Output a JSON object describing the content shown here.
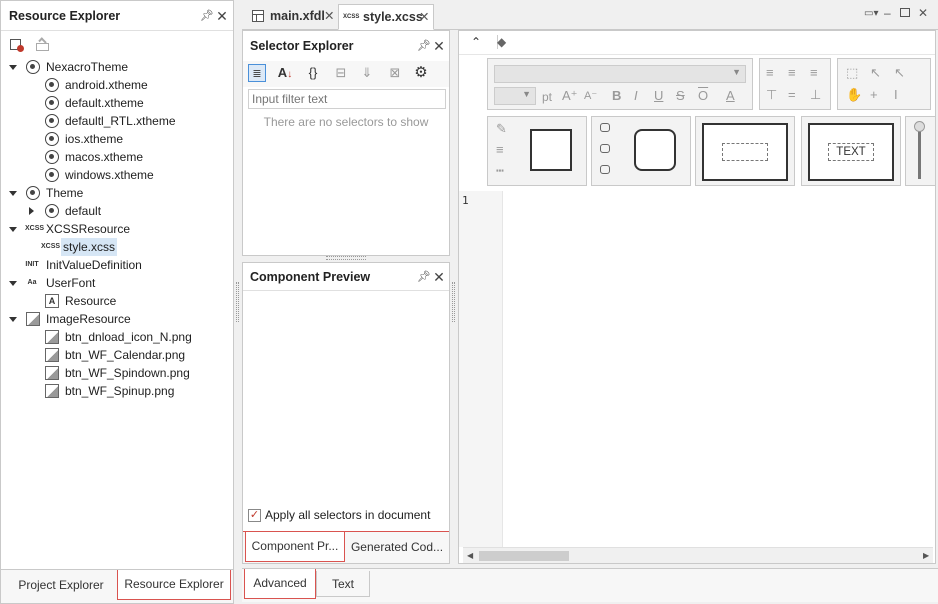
{
  "resource_explorer": {
    "title": "Resource Explorer",
    "tree": [
      {
        "label": "NexacroTheme",
        "icon": "theme-folder-icon",
        "expanded": true
      },
      {
        "label": "android.xtheme",
        "icon": "xtheme-icon"
      },
      {
        "label": "default.xtheme",
        "icon": "xtheme-icon"
      },
      {
        "label": "defaultl_RTL.xtheme",
        "icon": "xtheme-icon"
      },
      {
        "label": "ios.xtheme",
        "icon": "xtheme-icon"
      },
      {
        "label": "macos.xtheme",
        "icon": "xtheme-icon"
      },
      {
        "label": "windows.xtheme",
        "icon": "xtheme-icon"
      },
      {
        "label": "Theme",
        "icon": "theme-folder-icon",
        "expanded": true
      },
      {
        "label": "default",
        "icon": "xtheme-icon",
        "expanded": false
      },
      {
        "label": "XCSSResource",
        "icon": "xcss-icon",
        "expanded": true
      },
      {
        "label": "style.xcss",
        "icon": "xcss-file-icon",
        "selected": true
      },
      {
        "label": "InitValueDefinition",
        "icon": "init-icon"
      },
      {
        "label": "UserFont",
        "icon": "font-icon",
        "expanded": true
      },
      {
        "label": "Resource",
        "icon": "font-file-icon"
      },
      {
        "label": "ImageResource",
        "icon": "image-folder-icon",
        "expanded": true
      },
      {
        "label": "btn_dnload_icon_N.png",
        "icon": "image-file-icon"
      },
      {
        "label": "btn_WF_Calendar.png",
        "icon": "image-file-icon"
      },
      {
        "label": "btn_WF_Spindown.png",
        "icon": "image-file-icon"
      },
      {
        "label": "btn_WF_Spinup.png",
        "icon": "image-file-icon"
      }
    ],
    "bottom_tabs": [
      "Project Explorer",
      "Resource Explorer"
    ],
    "active_bottom_tab": "Resource Explorer"
  },
  "doc_tabs": [
    {
      "label": "main.xfdl",
      "icon": "xfdl-icon"
    },
    {
      "label": "style.xcss",
      "icon": "xcss-icon",
      "active": true
    }
  ],
  "selector_explorer": {
    "title": "Selector Explorer",
    "filter_placeholder": "Input filter text",
    "empty_text": "There are no selectors to show"
  },
  "component_preview": {
    "title": "Component Preview",
    "apply_all_label": "Apply all selectors in document",
    "apply_all_checked": true,
    "tabs": [
      "Component Pr...",
      "Generated Cod..."
    ]
  },
  "editor": {
    "font_unit": "pt",
    "text_preview": "TEXT",
    "line_numbers": [
      "1"
    ]
  },
  "bottom_tabs": [
    "Advanced",
    "Text"
  ],
  "active_bottom_tab": "Advanced"
}
